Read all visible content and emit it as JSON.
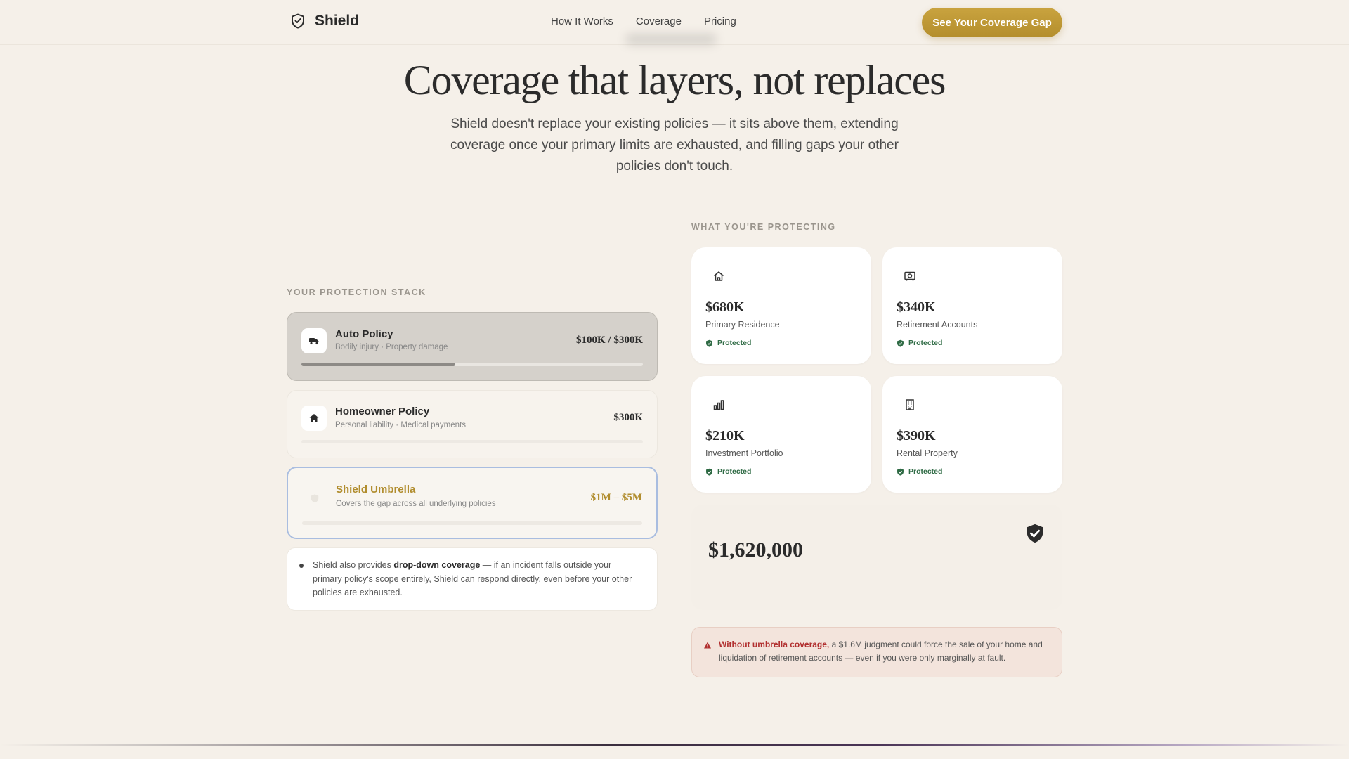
{
  "nav": {
    "brand": "Shield",
    "links": [
      "How It Works",
      "Coverage",
      "Pricing"
    ],
    "cta": "See Your Coverage Gap"
  },
  "hero": {
    "title": "Coverage that layers, not replaces",
    "subtitle": "Shield doesn't replace your existing policies — it sits above them, extending coverage once your primary limits are exhausted, and filling gaps your other policies don't touch."
  },
  "stack": {
    "label": "Your Protection Stack",
    "policies": [
      {
        "title": "Auto Policy",
        "subtitle": "Bodily injury · Property damage",
        "limit": "$100K / $300K",
        "icon": "truck-icon",
        "usage": 0.45
      },
      {
        "title": "Homeowner Policy",
        "subtitle": "Personal liability · Medical payments",
        "limit": "$300K",
        "icon": "house-icon",
        "usage": 0
      },
      {
        "title": "Shield Umbrella",
        "subtitle": "Covers the gap across all underlying policies",
        "limit": "$1M – $5M",
        "icon": "shield-icon",
        "usage": 0
      }
    ],
    "note": {
      "before": "Shield also provides ",
      "strong": "drop-down coverage",
      "after": " — if an incident falls outside your primary policy's scope entirely, Shield can respond directly, even before your other policies are exhausted."
    }
  },
  "assets": {
    "label": "What You're Protecting",
    "items": [
      {
        "value": "$680K",
        "label": "Primary Residence",
        "status": "Protected",
        "icon": "home-outline-icon"
      },
      {
        "value": "$340K",
        "label": "Retirement Accounts",
        "status": "Protected",
        "icon": "safe-icon"
      },
      {
        "value": "$210K",
        "label": "Investment Portfolio",
        "status": "Protected",
        "icon": "bar-chart-icon"
      },
      {
        "value": "$390K",
        "label": "Rental Property",
        "status": "Protected",
        "icon": "building-icon"
      }
    ],
    "total_value": "$1,620,000"
  },
  "warning": {
    "strong": "Without umbrella coverage,",
    "text": " a $1.6M judgment could force the sale of your home and liquidation of retirement accounts — even if you were only marginally at fault."
  },
  "colors": {
    "accent": "#b8922f",
    "background": "#f5f0e9",
    "protected": "#2f6b45",
    "danger": "#b12f2f"
  }
}
